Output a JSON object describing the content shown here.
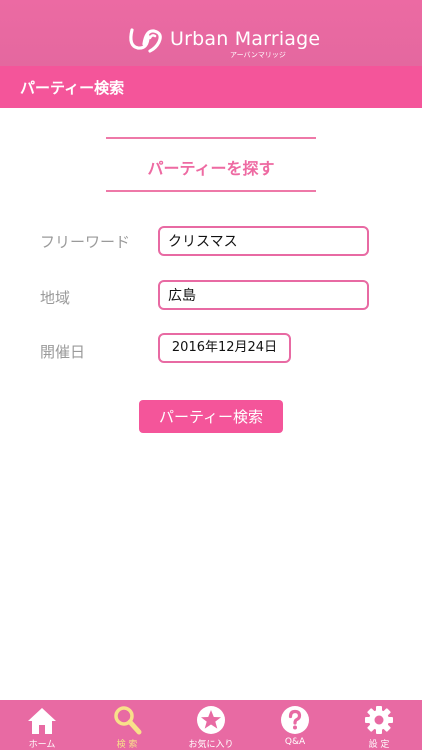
{
  "header": {
    "logo_text": "Urban Marriage",
    "logo_sub": "アーバンマリッジ"
  },
  "page_bar": {
    "title": "パーティー検索"
  },
  "section": {
    "title": "パーティーを探す"
  },
  "form": {
    "freeword": {
      "label": "フリーワード",
      "value": "クリスマス"
    },
    "region": {
      "label": "地域",
      "value": "広島"
    },
    "date": {
      "label": "開催日",
      "value": "2016年12月24日"
    }
  },
  "search_button": {
    "label": "パーティー検索"
  },
  "tabs": [
    {
      "label": "ホーム",
      "icon": "home-icon"
    },
    {
      "label": "検 索",
      "icon": "search-icon",
      "active": true
    },
    {
      "label": "お気に入り",
      "icon": "star-icon"
    },
    {
      "label": "Q&A",
      "icon": "question-icon"
    },
    {
      "label": "設 定",
      "icon": "gear-icon"
    }
  ],
  "colors": {
    "header": "#e86aa3",
    "accent": "#f4559a",
    "active_tab": "#f8e08a",
    "label_gray": "#9a9a9a"
  }
}
